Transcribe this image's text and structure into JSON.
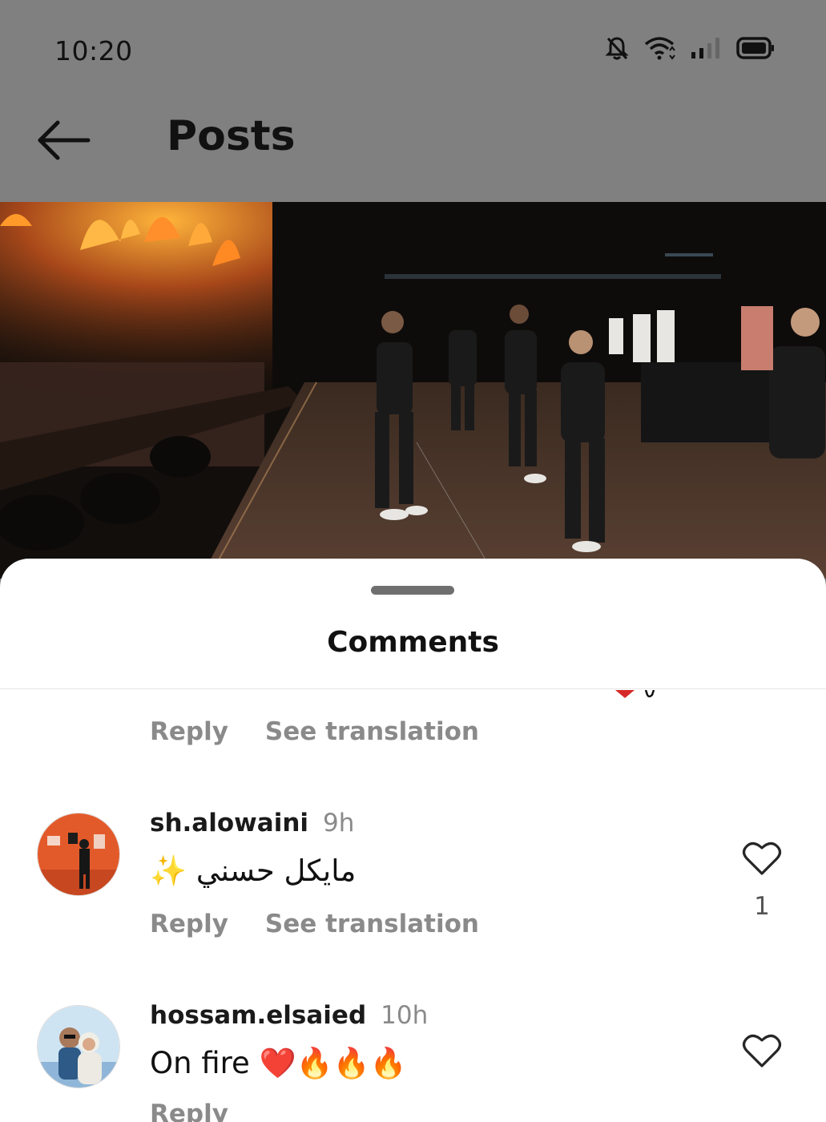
{
  "status_bar": {
    "time": "10:20",
    "icons": [
      "bell-muted-icon",
      "wifi-icon",
      "signal-icon",
      "battery-icon"
    ]
  },
  "header": {
    "back_icon": "arrow-left-icon",
    "title": "Posts"
  },
  "sheet": {
    "title": "Comments"
  },
  "comments": [
    {
      "username": "",
      "time": "",
      "text": "",
      "reply_label": "Reply",
      "translation_label": "See translation"
    },
    {
      "username": "sh.alowaini",
      "time": "9h",
      "text": "مايكل حسني ✨",
      "reply_label": "Reply",
      "translation_label": "See translation",
      "likes": "1"
    },
    {
      "username": "hossam.elsaied",
      "time": "10h",
      "text": "On fire ❤️🔥🔥🔥",
      "reply_label": "Reply"
    }
  ],
  "colors": {
    "overlay": "#808080",
    "secondary_text": "#8a8a8a",
    "heart_red": "#e02424"
  }
}
